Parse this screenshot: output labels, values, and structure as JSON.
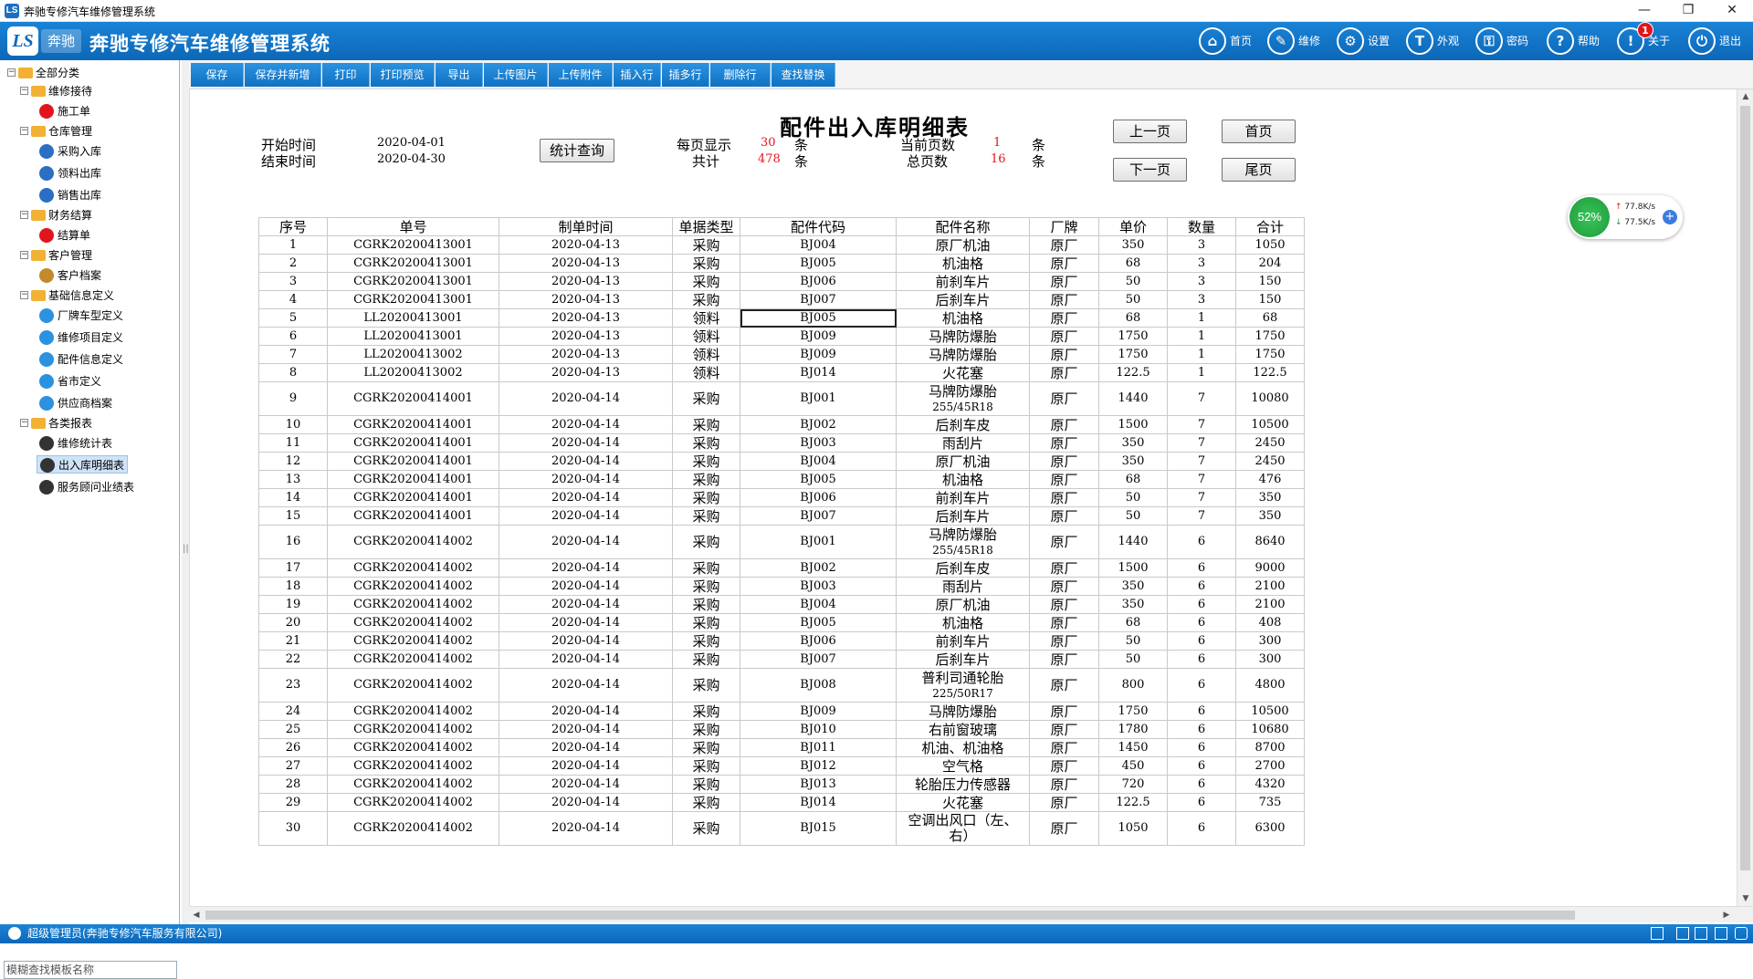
{
  "window": {
    "title": "奔驰专修汽车维修管理系统",
    "app_icon": "LS",
    "controls": [
      "—",
      "❐",
      "✕"
    ]
  },
  "header": {
    "logo_text": "LS",
    "logo_sub": "奔驰",
    "title": "奔驰专修汽车维修管理系统",
    "nav": [
      {
        "label": "首页",
        "icon": "home-icon",
        "glyph": "⌂"
      },
      {
        "label": "维修",
        "icon": "clipboard-icon",
        "glyph": "✎"
      },
      {
        "label": "设置",
        "icon": "gear-icon",
        "glyph": "⚙"
      },
      {
        "label": "外观",
        "icon": "shirt-icon",
        "glyph": "T"
      },
      {
        "label": "密码",
        "icon": "key-icon",
        "glyph": "⚿"
      },
      {
        "label": "帮助",
        "icon": "help-icon",
        "glyph": "?"
      },
      {
        "label": "关于",
        "icon": "info-icon",
        "glyph": "!",
        "badge": "1"
      },
      {
        "label": "退出",
        "icon": "exit-icon",
        "glyph": "⏻"
      }
    ]
  },
  "sidebar": {
    "root": "全部分类",
    "groups": [
      {
        "label": "维修接待",
        "items": [
          "施工单"
        ]
      },
      {
        "label": "仓库管理",
        "items": [
          "采购入库",
          "领料出库",
          "销售出库"
        ]
      },
      {
        "label": "财务结算",
        "items": [
          "结算单"
        ]
      },
      {
        "label": "客户管理",
        "items": [
          "客户档案"
        ]
      },
      {
        "label": "基础信息定义",
        "items": [
          "厂牌车型定义",
          "维修项目定义",
          "配件信息定义",
          "省市定义",
          "供应商档案"
        ]
      },
      {
        "label": "各类报表",
        "items": [
          "维修统计表",
          "出入库明细表",
          "服务顾问业绩表"
        ]
      }
    ],
    "search_placeholder": "模糊查找模板名称"
  },
  "toolbar": [
    "保存",
    "保存并新增",
    "打印",
    "打印预览",
    "导出",
    "上传图片",
    "上传附件",
    "插入行",
    "插多行",
    "删除行",
    "查找替换"
  ],
  "report": {
    "title": "配件出入库明细表",
    "start_label": "开始时间",
    "start_value": "2020-04-01",
    "end_label": "结束时间",
    "end_value": "2020-04-30",
    "query_button": "统计查询",
    "per_page_label": "每页显示",
    "per_page_value": "30",
    "total_label": "共计",
    "total_value": "478",
    "unit": "条",
    "current_page_label": "当前页数",
    "current_page_value": "1",
    "total_pages_label": "总页数",
    "total_pages_value": "16",
    "prev_button": "上一页",
    "first_button": "首页",
    "next_button": "下一页",
    "last_button": "尾页"
  },
  "table": {
    "columns": [
      "序号",
      "单号",
      "制单时间",
      "单据类型",
      "配件代码",
      "配件名称",
      "厂牌",
      "单价",
      "数量",
      "合计"
    ],
    "selected_cell": {
      "row": 5,
      "col": 4
    },
    "rows": [
      [
        "1",
        "CGRK20200413001",
        "2020-04-13",
        "采购",
        "BJ004",
        "原厂机油",
        "",
        "原厂",
        "350",
        "3",
        "1050"
      ],
      [
        "2",
        "CGRK20200413001",
        "2020-04-13",
        "采购",
        "BJ005",
        "机油格",
        "",
        "原厂",
        "68",
        "3",
        "204"
      ],
      [
        "3",
        "CGRK20200413001",
        "2020-04-13",
        "采购",
        "BJ006",
        "前刹车片",
        "",
        "原厂",
        "50",
        "3",
        "150"
      ],
      [
        "4",
        "CGRK20200413001",
        "2020-04-13",
        "采购",
        "BJ007",
        "后刹车片",
        "",
        "原厂",
        "50",
        "3",
        "150"
      ],
      [
        "5",
        "LL20200413001",
        "2020-04-13",
        "领料",
        "BJ005",
        "机油格",
        "",
        "原厂",
        "68",
        "1",
        "68"
      ],
      [
        "6",
        "LL20200413001",
        "2020-04-13",
        "领料",
        "BJ009",
        "马牌防爆胎",
        "",
        "原厂",
        "1750",
        "1",
        "1750"
      ],
      [
        "7",
        "LL20200413002",
        "2020-04-13",
        "领料",
        "BJ009",
        "马牌防爆胎",
        "",
        "原厂",
        "1750",
        "1",
        "1750"
      ],
      [
        "8",
        "LL20200413002",
        "2020-04-13",
        "领料",
        "BJ014",
        "火花塞",
        "",
        "原厂",
        "122.5",
        "1",
        "122.5"
      ],
      [
        "9",
        "CGRK20200414001",
        "2020-04-14",
        "采购",
        "BJ001",
        "马牌防爆胎",
        "255/45R18",
        "原厂",
        "1440",
        "7",
        "10080"
      ],
      [
        "10",
        "CGRK20200414001",
        "2020-04-14",
        "采购",
        "BJ002",
        "后刹车皮",
        "",
        "原厂",
        "1500",
        "7",
        "10500"
      ],
      [
        "11",
        "CGRK20200414001",
        "2020-04-14",
        "采购",
        "BJ003",
        "雨刮片",
        "",
        "原厂",
        "350",
        "7",
        "2450"
      ],
      [
        "12",
        "CGRK20200414001",
        "2020-04-14",
        "采购",
        "BJ004",
        "原厂机油",
        "",
        "原厂",
        "350",
        "7",
        "2450"
      ],
      [
        "13",
        "CGRK20200414001",
        "2020-04-14",
        "采购",
        "BJ005",
        "机油格",
        "",
        "原厂",
        "68",
        "7",
        "476"
      ],
      [
        "14",
        "CGRK20200414001",
        "2020-04-14",
        "采购",
        "BJ006",
        "前刹车片",
        "",
        "原厂",
        "50",
        "7",
        "350"
      ],
      [
        "15",
        "CGRK20200414001",
        "2020-04-14",
        "采购",
        "BJ007",
        "后刹车片",
        "",
        "原厂",
        "50",
        "7",
        "350"
      ],
      [
        "16",
        "CGRK20200414002",
        "2020-04-14",
        "采购",
        "BJ001",
        "马牌防爆胎",
        "255/45R18",
        "原厂",
        "1440",
        "6",
        "8640"
      ],
      [
        "17",
        "CGRK20200414002",
        "2020-04-14",
        "采购",
        "BJ002",
        "后刹车皮",
        "",
        "原厂",
        "1500",
        "6",
        "9000"
      ],
      [
        "18",
        "CGRK20200414002",
        "2020-04-14",
        "采购",
        "BJ003",
        "雨刮片",
        "",
        "原厂",
        "350",
        "6",
        "2100"
      ],
      [
        "19",
        "CGRK20200414002",
        "2020-04-14",
        "采购",
        "BJ004",
        "原厂机油",
        "",
        "原厂",
        "350",
        "6",
        "2100"
      ],
      [
        "20",
        "CGRK20200414002",
        "2020-04-14",
        "采购",
        "BJ005",
        "机油格",
        "",
        "原厂",
        "68",
        "6",
        "408"
      ],
      [
        "21",
        "CGRK20200414002",
        "2020-04-14",
        "采购",
        "BJ006",
        "前刹车片",
        "",
        "原厂",
        "50",
        "6",
        "300"
      ],
      [
        "22",
        "CGRK20200414002",
        "2020-04-14",
        "采购",
        "BJ007",
        "后刹车片",
        "",
        "原厂",
        "50",
        "6",
        "300"
      ],
      [
        "23",
        "CGRK20200414002",
        "2020-04-14",
        "采购",
        "BJ008",
        "普利司通轮胎",
        "225/50R17",
        "原厂",
        "800",
        "6",
        "4800"
      ],
      [
        "24",
        "CGRK20200414002",
        "2020-04-14",
        "采购",
        "BJ009",
        "马牌防爆胎",
        "",
        "原厂",
        "1750",
        "6",
        "10500"
      ],
      [
        "25",
        "CGRK20200414002",
        "2020-04-14",
        "采购",
        "BJ010",
        "右前窗玻璃",
        "",
        "原厂",
        "1780",
        "6",
        "10680"
      ],
      [
        "26",
        "CGRK20200414002",
        "2020-04-14",
        "采购",
        "BJ011",
        "机油、机油格",
        "",
        "原厂",
        "1450",
        "6",
        "8700"
      ],
      [
        "27",
        "CGRK20200414002",
        "2020-04-14",
        "采购",
        "BJ012",
        "空气格",
        "",
        "原厂",
        "450",
        "6",
        "2700"
      ],
      [
        "28",
        "CGRK20200414002",
        "2020-04-14",
        "采购",
        "BJ013",
        "轮胎压力传感器",
        "",
        "原厂",
        "720",
        "6",
        "4320"
      ],
      [
        "29",
        "CGRK20200414002",
        "2020-04-14",
        "采购",
        "BJ014",
        "火花塞",
        "",
        "原厂",
        "122.5",
        "6",
        "735"
      ],
      [
        "30",
        "CGRK20200414002",
        "2020-04-14",
        "采购",
        "BJ015",
        "空调出风口（左、",
        "右）",
        "原厂",
        "1050",
        "6",
        "6300"
      ]
    ]
  },
  "net_widget": {
    "percent": "52%",
    "up": "77.8K/s",
    "down": "77.5K/s"
  },
  "status": {
    "user": "超级管理员(奔驰专修汽车服务有限公司)"
  },
  "colors": {
    "brand": "#0c67b8",
    "accent": "#2b92e0",
    "red": "#e0161c"
  }
}
